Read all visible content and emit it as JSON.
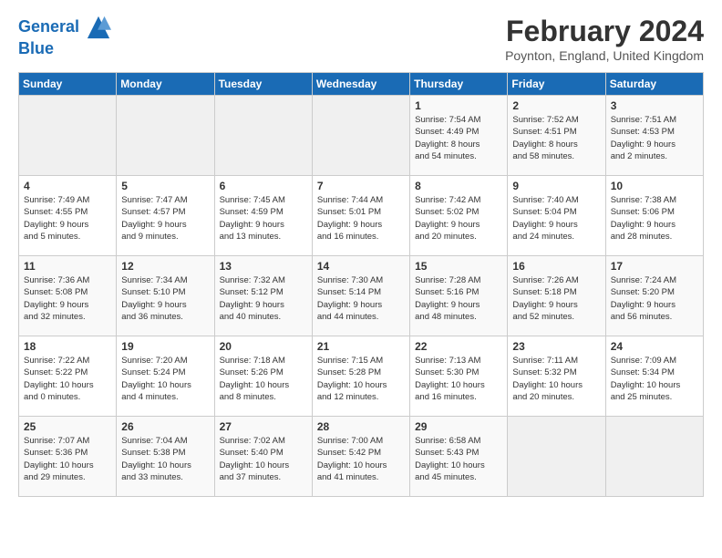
{
  "header": {
    "logo_line1": "General",
    "logo_line2": "Blue",
    "month": "February 2024",
    "location": "Poynton, England, United Kingdom"
  },
  "weekdays": [
    "Sunday",
    "Monday",
    "Tuesday",
    "Wednesday",
    "Thursday",
    "Friday",
    "Saturday"
  ],
  "weeks": [
    [
      {
        "day": "",
        "info": ""
      },
      {
        "day": "",
        "info": ""
      },
      {
        "day": "",
        "info": ""
      },
      {
        "day": "",
        "info": ""
      },
      {
        "day": "1",
        "info": "Sunrise: 7:54 AM\nSunset: 4:49 PM\nDaylight: 8 hours\nand 54 minutes."
      },
      {
        "day": "2",
        "info": "Sunrise: 7:52 AM\nSunset: 4:51 PM\nDaylight: 8 hours\nand 58 minutes."
      },
      {
        "day": "3",
        "info": "Sunrise: 7:51 AM\nSunset: 4:53 PM\nDaylight: 9 hours\nand 2 minutes."
      }
    ],
    [
      {
        "day": "4",
        "info": "Sunrise: 7:49 AM\nSunset: 4:55 PM\nDaylight: 9 hours\nand 5 minutes."
      },
      {
        "day": "5",
        "info": "Sunrise: 7:47 AM\nSunset: 4:57 PM\nDaylight: 9 hours\nand 9 minutes."
      },
      {
        "day": "6",
        "info": "Sunrise: 7:45 AM\nSunset: 4:59 PM\nDaylight: 9 hours\nand 13 minutes."
      },
      {
        "day": "7",
        "info": "Sunrise: 7:44 AM\nSunset: 5:01 PM\nDaylight: 9 hours\nand 16 minutes."
      },
      {
        "day": "8",
        "info": "Sunrise: 7:42 AM\nSunset: 5:02 PM\nDaylight: 9 hours\nand 20 minutes."
      },
      {
        "day": "9",
        "info": "Sunrise: 7:40 AM\nSunset: 5:04 PM\nDaylight: 9 hours\nand 24 minutes."
      },
      {
        "day": "10",
        "info": "Sunrise: 7:38 AM\nSunset: 5:06 PM\nDaylight: 9 hours\nand 28 minutes."
      }
    ],
    [
      {
        "day": "11",
        "info": "Sunrise: 7:36 AM\nSunset: 5:08 PM\nDaylight: 9 hours\nand 32 minutes."
      },
      {
        "day": "12",
        "info": "Sunrise: 7:34 AM\nSunset: 5:10 PM\nDaylight: 9 hours\nand 36 minutes."
      },
      {
        "day": "13",
        "info": "Sunrise: 7:32 AM\nSunset: 5:12 PM\nDaylight: 9 hours\nand 40 minutes."
      },
      {
        "day": "14",
        "info": "Sunrise: 7:30 AM\nSunset: 5:14 PM\nDaylight: 9 hours\nand 44 minutes."
      },
      {
        "day": "15",
        "info": "Sunrise: 7:28 AM\nSunset: 5:16 PM\nDaylight: 9 hours\nand 48 minutes."
      },
      {
        "day": "16",
        "info": "Sunrise: 7:26 AM\nSunset: 5:18 PM\nDaylight: 9 hours\nand 52 minutes."
      },
      {
        "day": "17",
        "info": "Sunrise: 7:24 AM\nSunset: 5:20 PM\nDaylight: 9 hours\nand 56 minutes."
      }
    ],
    [
      {
        "day": "18",
        "info": "Sunrise: 7:22 AM\nSunset: 5:22 PM\nDaylight: 10 hours\nand 0 minutes."
      },
      {
        "day": "19",
        "info": "Sunrise: 7:20 AM\nSunset: 5:24 PM\nDaylight: 10 hours\nand 4 minutes."
      },
      {
        "day": "20",
        "info": "Sunrise: 7:18 AM\nSunset: 5:26 PM\nDaylight: 10 hours\nand 8 minutes."
      },
      {
        "day": "21",
        "info": "Sunrise: 7:15 AM\nSunset: 5:28 PM\nDaylight: 10 hours\nand 12 minutes."
      },
      {
        "day": "22",
        "info": "Sunrise: 7:13 AM\nSunset: 5:30 PM\nDaylight: 10 hours\nand 16 minutes."
      },
      {
        "day": "23",
        "info": "Sunrise: 7:11 AM\nSunset: 5:32 PM\nDaylight: 10 hours\nand 20 minutes."
      },
      {
        "day": "24",
        "info": "Sunrise: 7:09 AM\nSunset: 5:34 PM\nDaylight: 10 hours\nand 25 minutes."
      }
    ],
    [
      {
        "day": "25",
        "info": "Sunrise: 7:07 AM\nSunset: 5:36 PM\nDaylight: 10 hours\nand 29 minutes."
      },
      {
        "day": "26",
        "info": "Sunrise: 7:04 AM\nSunset: 5:38 PM\nDaylight: 10 hours\nand 33 minutes."
      },
      {
        "day": "27",
        "info": "Sunrise: 7:02 AM\nSunset: 5:40 PM\nDaylight: 10 hours\nand 37 minutes."
      },
      {
        "day": "28",
        "info": "Sunrise: 7:00 AM\nSunset: 5:42 PM\nDaylight: 10 hours\nand 41 minutes."
      },
      {
        "day": "29",
        "info": "Sunrise: 6:58 AM\nSunset: 5:43 PM\nDaylight: 10 hours\nand 45 minutes."
      },
      {
        "day": "",
        "info": ""
      },
      {
        "day": "",
        "info": ""
      }
    ]
  ]
}
